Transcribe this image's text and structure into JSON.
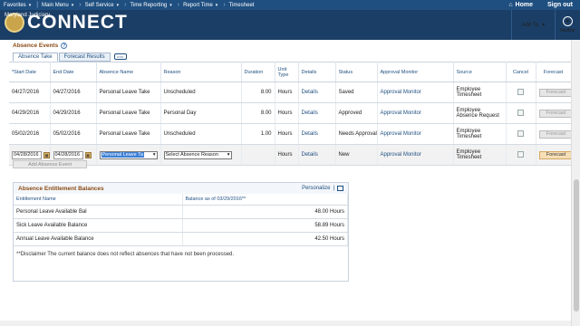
{
  "menu": {
    "items": [
      "Favorites",
      "Main Menu",
      "Self Service",
      "Time Reporting",
      "Report Time",
      "Timesheet"
    ],
    "home": "Home",
    "signout": "Sign out"
  },
  "header": {
    "logo_text": "CONNECT",
    "logo_sub": "Maryland Judiciary",
    "add_to": "Add To",
    "navbar": "NavBar"
  },
  "section": {
    "title": "Absence Events",
    "tabs": [
      "Absence Take",
      "Forecast Results"
    ]
  },
  "grid": {
    "headers": [
      "*Start Date",
      "End Date",
      "Absence Name",
      "Reason",
      "Duration",
      "Unit Type",
      "Details",
      "Status",
      "Approval Monitor",
      "Source",
      "Cancel",
      "Forecast"
    ],
    "rows": [
      {
        "start": "04/27/2016",
        "end": "04/27/2016",
        "name": "Personal Leave Take",
        "reason": "Unscheduled",
        "duration": "8.00",
        "unit": "Hours",
        "details": "Details",
        "status": "Saved",
        "monitor": "Approval Monitor",
        "source": "Employee Timesheet",
        "forecast": "Forecast"
      },
      {
        "start": "04/29/2016",
        "end": "04/29/2016",
        "name": "Personal Leave Take",
        "reason": "Personal Day",
        "duration": "8.00",
        "unit": "Hours",
        "details": "Details",
        "status": "Approved",
        "monitor": "Approval Monitor",
        "source": "Employee Absence Request",
        "forecast": "Forecast"
      },
      {
        "start": "05/02/2016",
        "end": "05/02/2016",
        "name": "Personal Leave Take",
        "reason": "Unscheduled",
        "duration": "1.00",
        "unit": "Hours",
        "details": "Details",
        "status": "Needs Approval",
        "monitor": "Approval Monitor",
        "source": "Employee Timesheet",
        "forecast": "Forecast"
      }
    ],
    "new_row": {
      "start": "04/28/2016",
      "end": "04/28/2016",
      "name": "Personal Leave Ta",
      "reason": "Select Absence Reason",
      "unit": "Hours",
      "details": "Details",
      "status": "New",
      "monitor": "Approval Monitor",
      "source": "Employee Timesheet",
      "forecast": "Forecast"
    },
    "add_button": "Add Absence Event"
  },
  "balances": {
    "title": "Absence Entitlement Balances",
    "personalize": "Personalize",
    "col_name": "Entitlement Name",
    "col_balance": "Balance as of 03/29/2016**",
    "rows": [
      {
        "name": "Personal Leave Available Bal",
        "value": "48.00 Hours"
      },
      {
        "name": "Sick Leave Available Balance",
        "value": "58.89 Hours"
      },
      {
        "name": "Annual Leave Available Balance",
        "value": "42.50 Hours"
      }
    ]
  },
  "disclaimer": "**Disclaimer  The current balance does not reflect absences that have not been processed."
}
